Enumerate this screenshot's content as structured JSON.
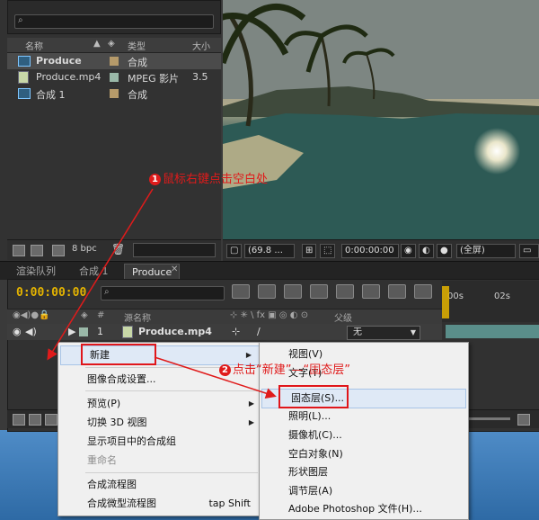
{
  "project": {
    "columns": {
      "name": "名称",
      "type": "类型",
      "size": "大小"
    },
    "items": [
      {
        "name": "Produce",
        "type": "合成",
        "size": "",
        "swatch": "#b59a6a",
        "icon": "composition-icon",
        "selected": true
      },
      {
        "name": "Produce.mp4",
        "type": "MPEG 影片",
        "size": "3.5",
        "swatch": "#9ab8a8",
        "icon": "video-file-icon",
        "selected": false
      },
      {
        "name": "合成 1",
        "type": "合成",
        "size": "",
        "swatch": "#b59a6a",
        "icon": "composition-icon",
        "selected": false
      }
    ],
    "bpc": "8 bpc"
  },
  "viewer": {
    "zoom": "(69.8 ...",
    "timecode": "0:00:00:00",
    "resolution": "(全屏)"
  },
  "tabs": [
    {
      "label": "渲染队列",
      "active": false
    },
    {
      "label": "合成 1",
      "active": false
    },
    {
      "label": "Produce",
      "active": true
    }
  ],
  "timeline": {
    "timecode": "0:00:00:00",
    "ruler": [
      "00s",
      "02s"
    ],
    "headers": {
      "index": "#",
      "source": "源名称",
      "parent": "父级"
    },
    "layer": {
      "index": "1",
      "name": "Produce.mp4",
      "parent": "无"
    }
  },
  "context_menu": {
    "items": [
      {
        "label": "新建",
        "submenu": true,
        "disabled": false
      },
      {
        "label": "图像合成设置...",
        "submenu": false,
        "disabled": false
      },
      {
        "label": "预览(P)",
        "submenu": true,
        "disabled": false
      },
      {
        "label": "切换 3D 视图",
        "submenu": true,
        "disabled": false
      },
      {
        "label": "显示项目中的合成组",
        "submenu": false,
        "disabled": false
      },
      {
        "label": "重命名",
        "submenu": false,
        "disabled": true
      },
      {
        "label": "合成流程图",
        "submenu": false,
        "disabled": false
      },
      {
        "label": "合成微型流程图",
        "shortcut": "tap Shift",
        "submenu": false,
        "disabled": false
      }
    ]
  },
  "submenu": {
    "items": [
      "视图(V)",
      "文字(T)",
      "固态层(S)...",
      "照明(L)...",
      "摄像机(C)...",
      "空白对象(N)",
      "形状图层",
      "调节层(A)",
      "Adobe Photoshop 文件(H)..."
    ]
  },
  "annotations": {
    "step1_num": "1",
    "step1_text": "鼠标右键点击空白处",
    "step2_num": "2",
    "step2_text": "点击“新建”—“固态层”"
  },
  "colors": {
    "accent_annotation": "#e01b1b",
    "timecode": "#e5b400"
  }
}
